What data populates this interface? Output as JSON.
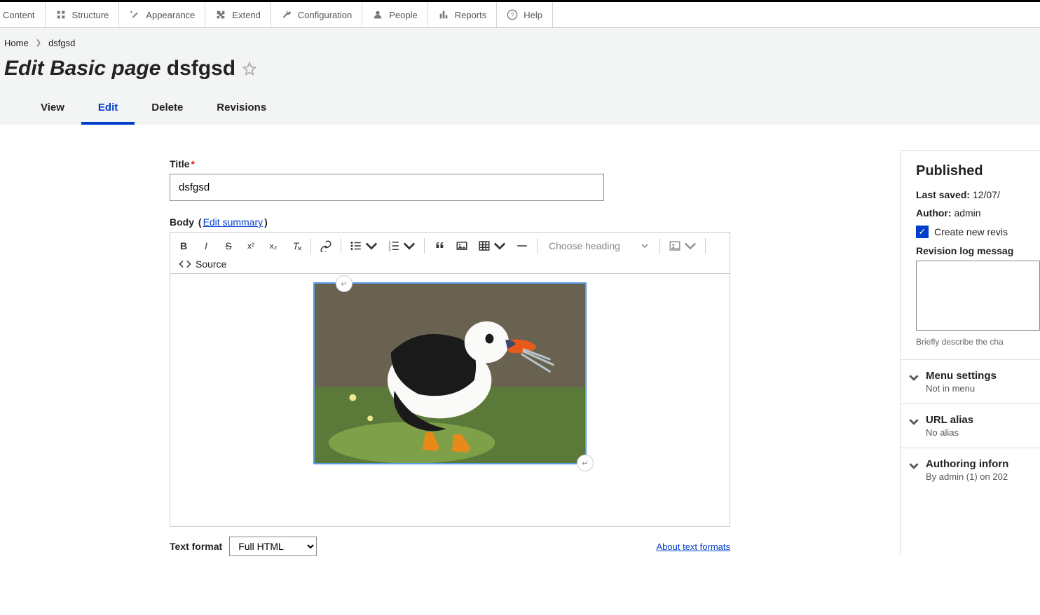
{
  "toolbar": {
    "items": [
      {
        "label": "Content",
        "icon": "content"
      },
      {
        "label": "Structure",
        "icon": "structure"
      },
      {
        "label": "Appearance",
        "icon": "appearance"
      },
      {
        "label": "Extend",
        "icon": "extend"
      },
      {
        "label": "Configuration",
        "icon": "config"
      },
      {
        "label": "People",
        "icon": "people"
      },
      {
        "label": "Reports",
        "icon": "reports"
      },
      {
        "label": "Help",
        "icon": "help"
      }
    ]
  },
  "breadcrumb": {
    "home": "Home",
    "current": "dsfgsd"
  },
  "page_title_prefix": "Edit Basic page",
  "page_title_name": "dsfgsd",
  "tabs": [
    {
      "label": "View",
      "active": false
    },
    {
      "label": "Edit",
      "active": true
    },
    {
      "label": "Delete",
      "active": false
    },
    {
      "label": "Revisions",
      "active": false
    }
  ],
  "form": {
    "title_label": "Title",
    "title_value": "dsfgsd",
    "body_label": "Body",
    "edit_summary": "Edit summary",
    "heading_placeholder": "Choose heading",
    "source_label": "Source",
    "text_format_label": "Text format",
    "text_format_value": "Full HTML",
    "about_formats": "About text formats"
  },
  "sidebar": {
    "published": "Published",
    "last_saved_label": "Last saved:",
    "last_saved_value": "12/07/",
    "author_label": "Author:",
    "author_value": "admin",
    "create_revision": "Create new revis",
    "rev_log_label": "Revision log messag",
    "rev_help": "Briefly describe the cha",
    "accordion": [
      {
        "title": "Menu settings",
        "sub": "Not in menu"
      },
      {
        "title": "URL alias",
        "sub": "No alias"
      },
      {
        "title": "Authoring inforn",
        "sub": "By admin (1) on 202"
      }
    ]
  }
}
